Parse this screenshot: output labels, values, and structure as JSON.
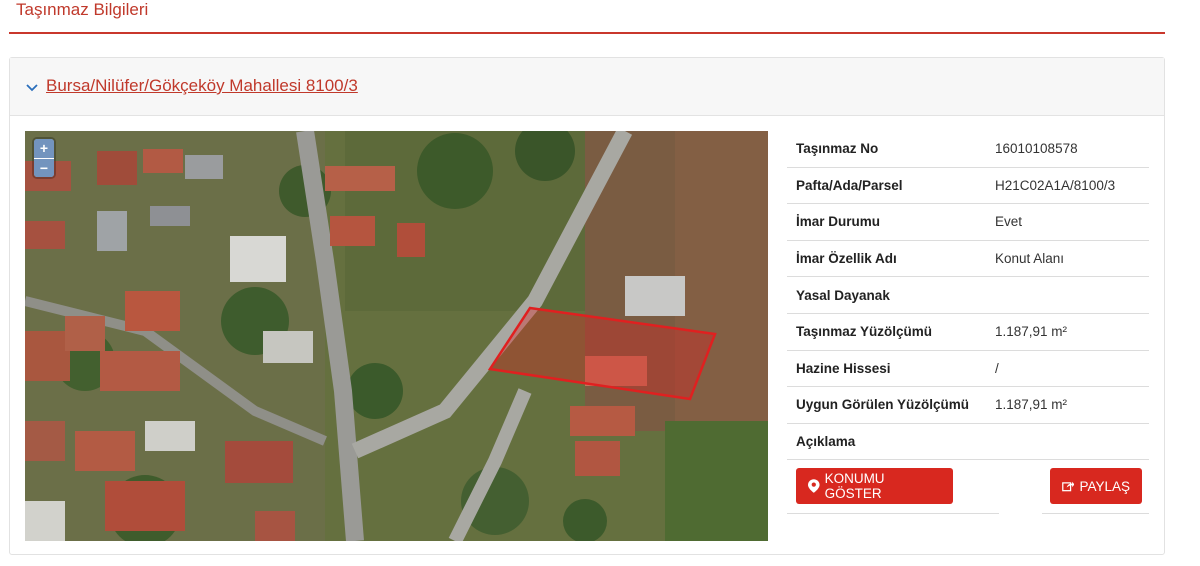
{
  "page": {
    "title": "Taşınmaz Bilgileri"
  },
  "card": {
    "title": "Bursa/Nilüfer/Gökçeköy Mahallesi 8100/3"
  },
  "map": {
    "zoom_in": "+",
    "zoom_out": "−"
  },
  "info": {
    "rows": [
      {
        "label": "Taşınmaz No",
        "value": "16010108578"
      },
      {
        "label": "Pafta/Ada/Parsel",
        "value": "H21C02A1A/8100/3"
      },
      {
        "label": "İmar Durumu",
        "value": "Evet"
      },
      {
        "label": "İmar Özellik Adı",
        "value": "Konut Alanı"
      },
      {
        "label": "Yasal Dayanak",
        "value": ""
      },
      {
        "label": "Taşınmaz Yüzölçümü",
        "value": "1.187,91 m²"
      },
      {
        "label": "Hazine Hissesi",
        "value": "/"
      },
      {
        "label": "Uygun Görülen Yüzölçümü",
        "value": "1.187,91 m²"
      },
      {
        "label": "Açıklama",
        "value": ""
      }
    ]
  },
  "buttons": {
    "show_location": "KONUMU GÖSTER",
    "share": "PAYLAŞ"
  },
  "colors": {
    "accent": "#c0392b",
    "button": "#d8281f",
    "parcel": "#e02020"
  },
  "icons": {
    "chevron": "chevron-down-icon",
    "location": "map-marker-icon",
    "share": "share-icon"
  }
}
